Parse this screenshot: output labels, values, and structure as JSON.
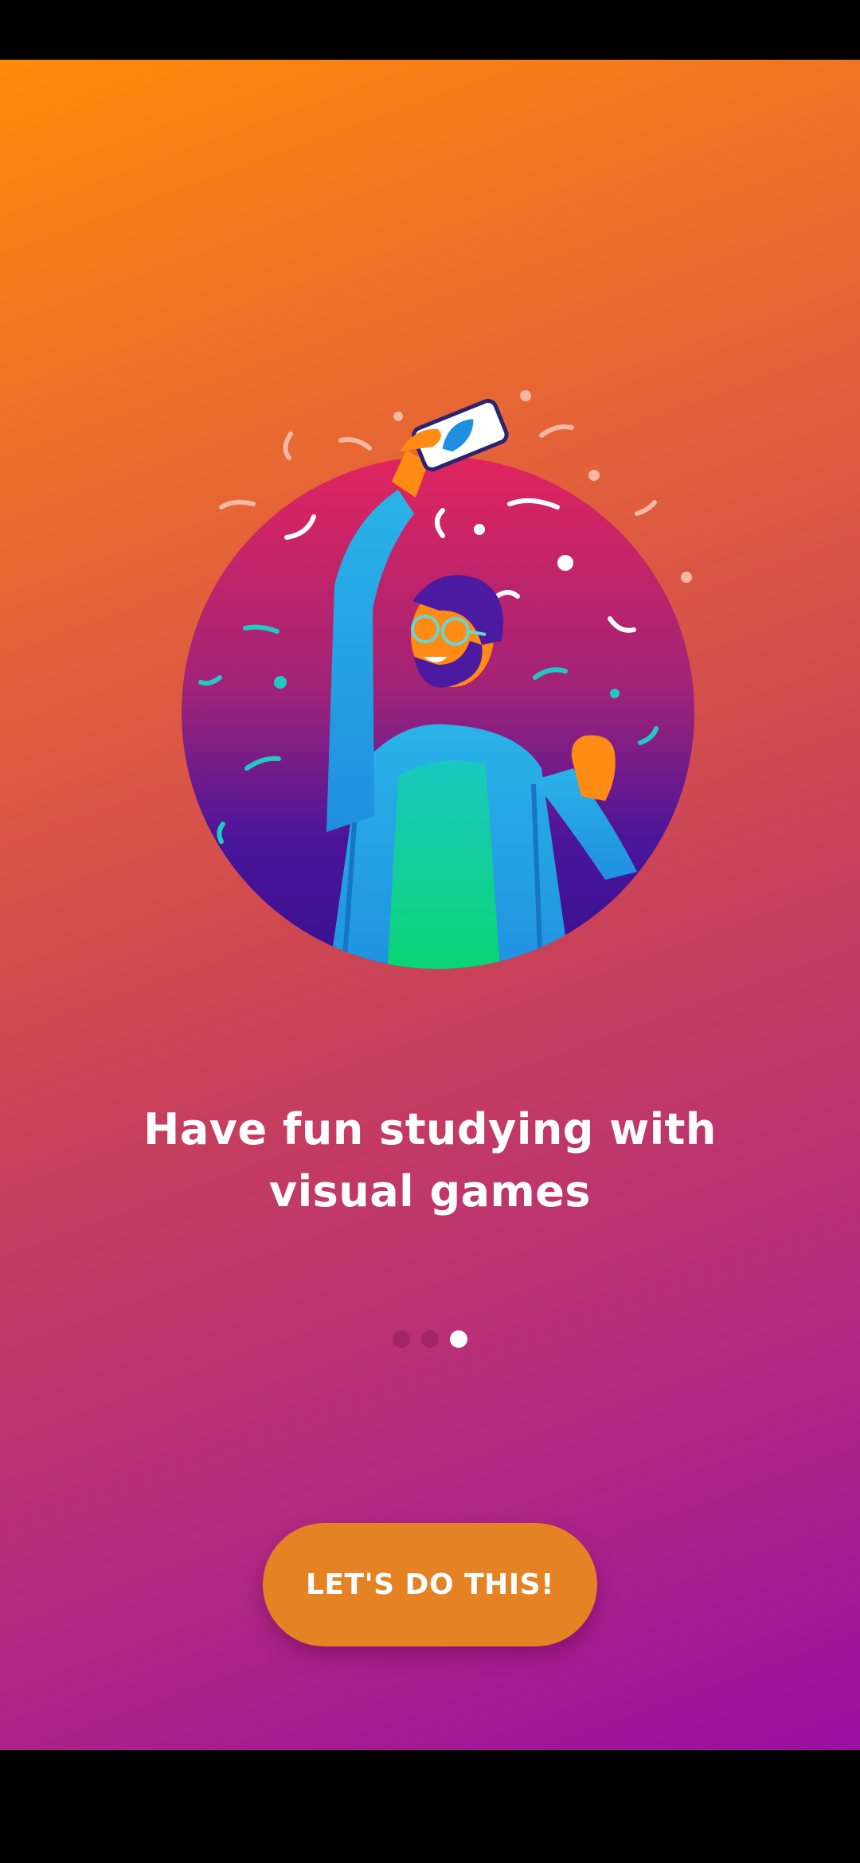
{
  "onboarding": {
    "headline": "Have fun studying with visual games",
    "pager": {
      "total": 3,
      "active_index": 2
    },
    "cta_label": "LET'S DO THIS!"
  },
  "colors": {
    "gradient_top": "#ff8a0a",
    "gradient_bottom": "#9a0ea0",
    "button": "#e58324",
    "text": "#ffffff"
  },
  "icons": {
    "illustration": "celebrating-man-holding-phone-illustration"
  }
}
